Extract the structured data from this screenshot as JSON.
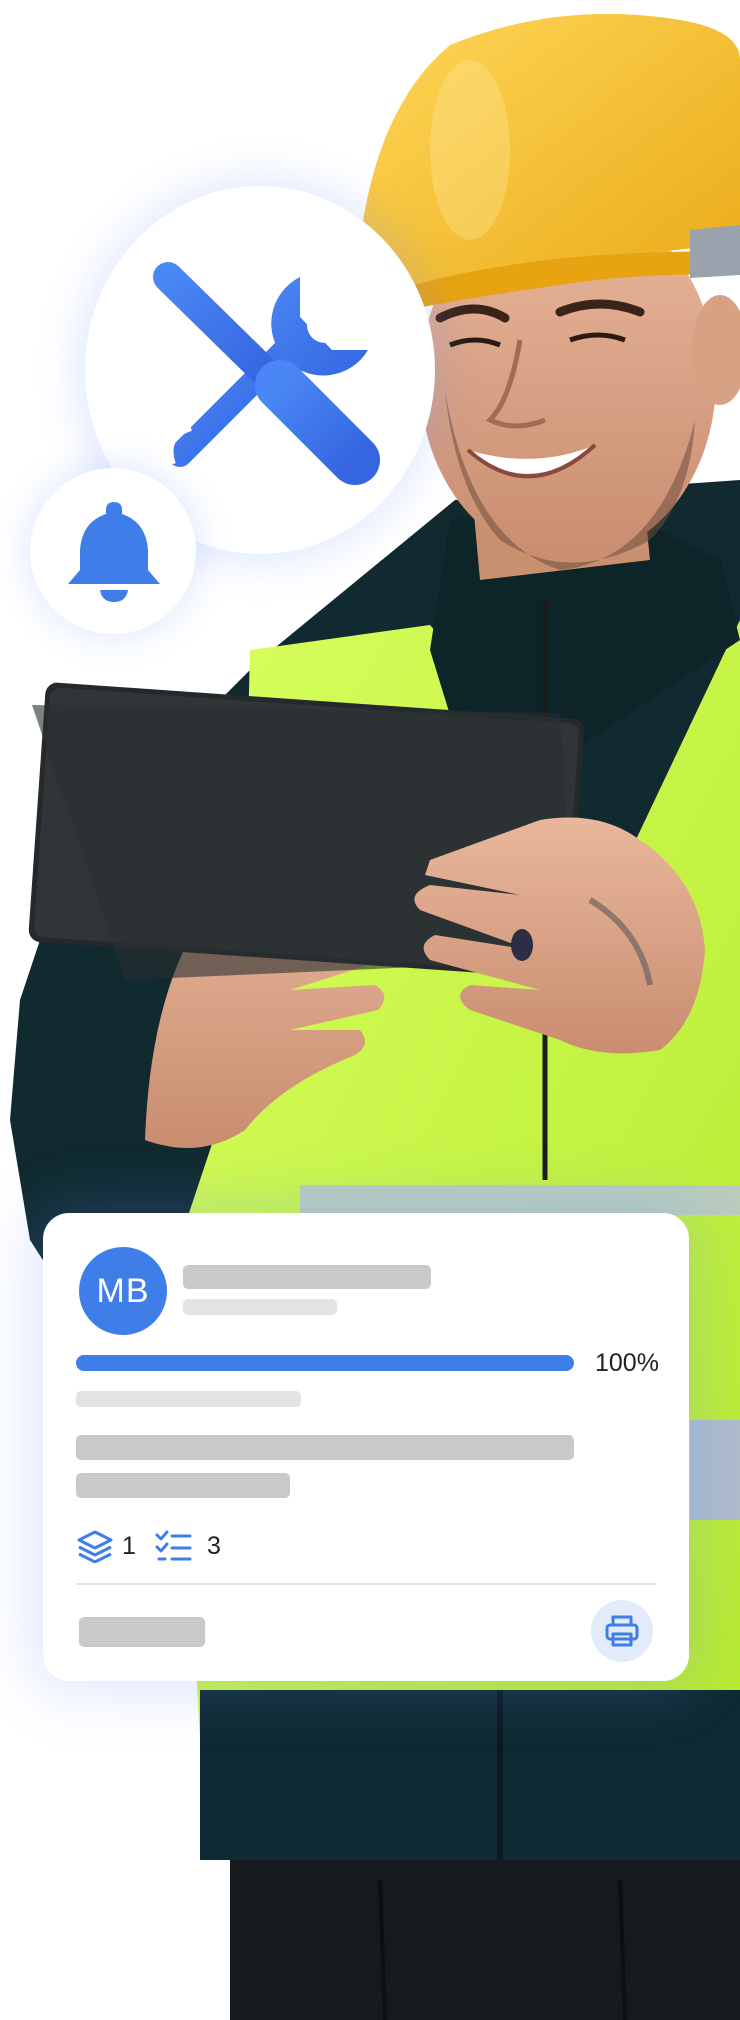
{
  "card": {
    "avatar_initials": "MB",
    "progress": {
      "value": 1.0,
      "label": "100%"
    },
    "stats": {
      "layers": {
        "icon": "layers-icon",
        "count": "1"
      },
      "tasks": {
        "icon": "checklist-icon",
        "count": "3"
      }
    },
    "print_icon": "printer-icon"
  },
  "icons": {
    "tools": "tools-icon",
    "bell": "bell-icon"
  },
  "colors": {
    "accent": "#3f7ee8",
    "placeholder": "#c9c9c9",
    "vest": "#c8f542",
    "helmet": "#f6c12b"
  }
}
